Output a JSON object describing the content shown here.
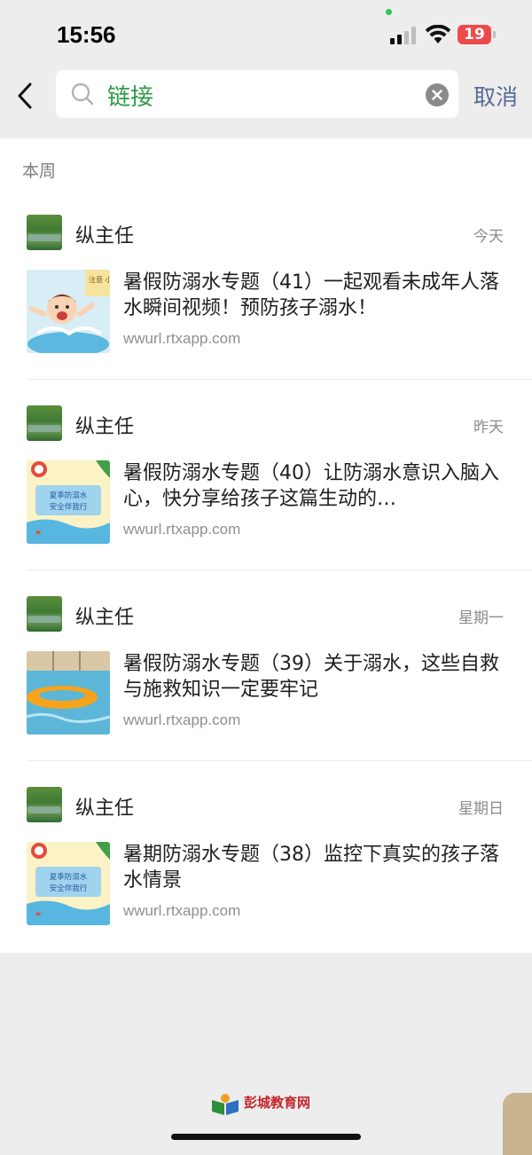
{
  "status": {
    "time": "15:56",
    "battery": "19"
  },
  "search": {
    "query": "链接",
    "cancel_label": "取消"
  },
  "section_label": "本周",
  "results": [
    {
      "author": "纵主任",
      "day": "今天",
      "title": "暑假防溺水专题（41）一起观看未成年人落水瞬间视频！预防孩子溺水！",
      "url": "wwurl.rtxapp.com",
      "thumb_text": "注意\n小心"
    },
    {
      "author": "纵主任",
      "day": "昨天",
      "title": "暑假防溺水专题（40）让防溺水意识入脑入心，快分享给孩子这篇生动的…",
      "url": "wwurl.rtxapp.com",
      "thumb_text": "夏季防溺水\n安全伴我行"
    },
    {
      "author": "纵主任",
      "day": "星期一",
      "title": "暑假防溺水专题（39）关于溺水，这些自救与施救知识一定要牢记",
      "url": "wwurl.rtxapp.com",
      "thumb_text": ""
    },
    {
      "author": "纵主任",
      "day": "星期日",
      "title": "暑期防溺水专题（38）监控下真实的孩子落水情景",
      "url": "wwurl.rtxapp.com",
      "thumb_text": "夏季防溺水\n安全伴我行"
    }
  ],
  "watermark": "彭城教育网",
  "colors": {
    "accent_green": "#2e9a49",
    "cancel_blue": "#576b95",
    "battery_red": "#ee4a4a"
  }
}
